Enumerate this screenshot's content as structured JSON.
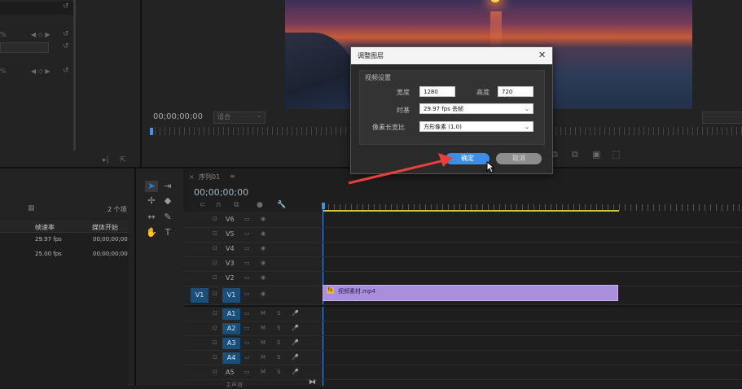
{
  "effect_controls": {
    "rows": [
      {
        "value": "%",
        "reset": "↺"
      },
      {
        "value": "%",
        "reset": "↺"
      },
      {
        "value": "%",
        "reset": "↺"
      }
    ]
  },
  "program_monitor": {
    "timecode": "00;00;00;00",
    "fit": "适合"
  },
  "project_panel": {
    "item_count": "2 个项",
    "columns": {
      "frame_rate": "帧速率",
      "media_start": "媒体开始"
    },
    "rows": [
      {
        "frame_rate": "29.97 fps",
        "media_start": "00;00;00;00"
      },
      {
        "frame_rate": "25.00 fps",
        "media_start": "00;00;00;00"
      }
    ]
  },
  "timeline": {
    "sequence_tab": "序列01",
    "timecode": "00;00;00;00",
    "video_tracks": [
      "V6",
      "V5",
      "V4",
      "V3",
      "V2",
      "V1"
    ],
    "source_v": "V1",
    "audio_tracks": [
      "A1",
      "A2",
      "A3",
      "A4",
      "A5"
    ],
    "clip_label": "视频素材.mp4",
    "bottom_label": "主声道"
  },
  "dialog": {
    "title": "调整图层",
    "group_label": "视频设置",
    "width_label": "宽度",
    "width_value": "1280",
    "height_label": "高度",
    "height_value": "720",
    "timebase_label": "时基",
    "timebase_value": "29.97 fps 丢帧",
    "par_label": "像素长宽比",
    "par_value": "方形像素 (1.0)",
    "ok_label": "确定",
    "cancel_label": "取消",
    "colors": {
      "ok": "#3d8ee6",
      "cancel": "#8d8d8d"
    }
  },
  "annotation": {
    "arrow_color": "#e8403a"
  },
  "clip_color": "#a98ede",
  "track_accent": "#1a4f7a"
}
